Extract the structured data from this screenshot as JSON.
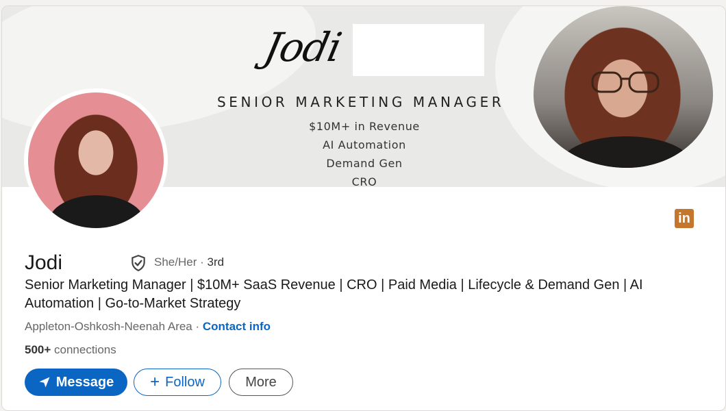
{
  "banner": {
    "signature": "Jodi",
    "title": "SENIOR MARKETING MANAGER",
    "lines": [
      "$10M+ in Revenue",
      "AI Automation",
      "Demand Gen",
      "CRO"
    ]
  },
  "profile": {
    "name": "Jodi",
    "pronouns": "She/Her",
    "separator": " · ",
    "degree": "3rd",
    "headline": "Senior Marketing Manager | $10M+ SaaS Revenue | CRO | Paid Media | Lifecycle & Demand Gen | AI Automation | Go-to-Market Strategy",
    "location": "Appleton-Oshkosh-Neenah Area",
    "location_separator": " · ",
    "contact_info": "Contact info",
    "connections_count": "500+",
    "connections_label": " connections"
  },
  "actions": {
    "message": "Message",
    "follow": "Follow",
    "more": "More"
  },
  "icons": {
    "linkedin_glyph": "in",
    "follow_plus": "+"
  },
  "colors": {
    "primary": "#0a66c2",
    "linkedin_badge": "#c3762c"
  }
}
